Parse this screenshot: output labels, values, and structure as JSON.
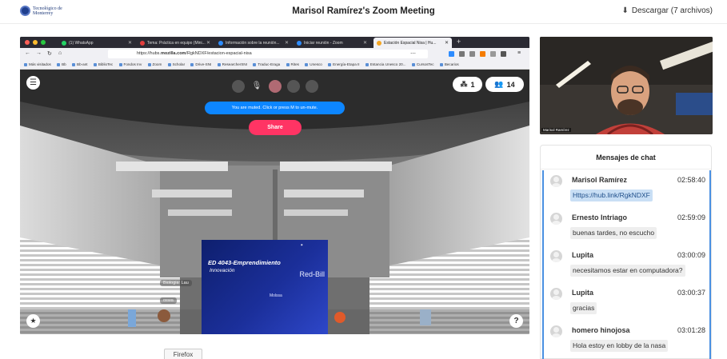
{
  "header": {
    "logo_text": "Tecnológico de Monterrey",
    "meeting_title": "Marisol Ramírez's Zoom Meeting",
    "download_label": "Descargar (7 archivos)"
  },
  "browser": {
    "tabs": [
      {
        "label": "(1) WhatsApp",
        "icon_color": "#25d366"
      },
      {
        "label": "Tema: Práctica en equipo (Mini...",
        "icon_color": "#e23d3d"
      },
      {
        "label": "Información sobre la reunión...",
        "icon_color": "#2d8cff"
      },
      {
        "label": "Iniciar reunión - Zoom",
        "icon_color": "#2d8cff"
      },
      {
        "label": "Estación Espacial Nisa | Hu...",
        "icon_color": "#f5a623"
      }
    ],
    "url_prefix": "https://hubs.",
    "url_domain": "mozilla.com",
    "url_path": "/RgkNDXF/estacion-espacial-nisa",
    "bookmarks": [
      "Más visitados",
      "Bb",
      "Bb-ant",
      "BiblioTec",
      "Fondos Inv",
      "Zoom",
      "Scholar",
      "Drive-SNI",
      "ResearcherSNI",
      "Traduc-Eraga",
      "Rites",
      "Unesco",
      "Energía-Etapa II",
      "Estancia Unesco 20...",
      "CursosTec",
      "Becarios"
    ],
    "app_label": "Firefox"
  },
  "hubs": {
    "users_in_room": "1",
    "users_count": "14",
    "muted_banner": "You are muted. Click or press M to un-mute.",
    "share_label": "Share",
    "help_label": "?",
    "poster": {
      "title": "ED 4043-Emprendimiento",
      "subtitle": "Innovación",
      "side_text": "Red-Bill",
      "molssa": "Molssa"
    },
    "nametags": [
      "Biologia: Lau",
      "oswa"
    ]
  },
  "webcam": {
    "name": "Marisol Ramírez"
  },
  "chat": {
    "title": "Mensajes de chat",
    "messages": [
      {
        "sender": "Marisol Ramírez",
        "time": "02:58:40",
        "text": "Https://hub.link/RgkNDXF",
        "is_link": true
      },
      {
        "sender": "Ernesto Intriago",
        "time": "02:59:09",
        "text": "buenas tardes, no escucho",
        "is_link": false
      },
      {
        "sender": "Lupita",
        "time": "03:00:09",
        "text": "necesitamos estar en computadora?",
        "is_link": false
      },
      {
        "sender": "Lupita",
        "time": "03:00:37",
        "text": "gracias",
        "is_link": false
      },
      {
        "sender": "homero hinojosa",
        "time": "03:01:28",
        "text": "Hola estoy en lobby de la nasa",
        "is_link": false
      }
    ]
  },
  "colors": {
    "accent_blue": "#0d86ff",
    "share_pink": "#ff3464",
    "chat_border": "#4a90e2",
    "link_bubble": "#c9dff5"
  }
}
